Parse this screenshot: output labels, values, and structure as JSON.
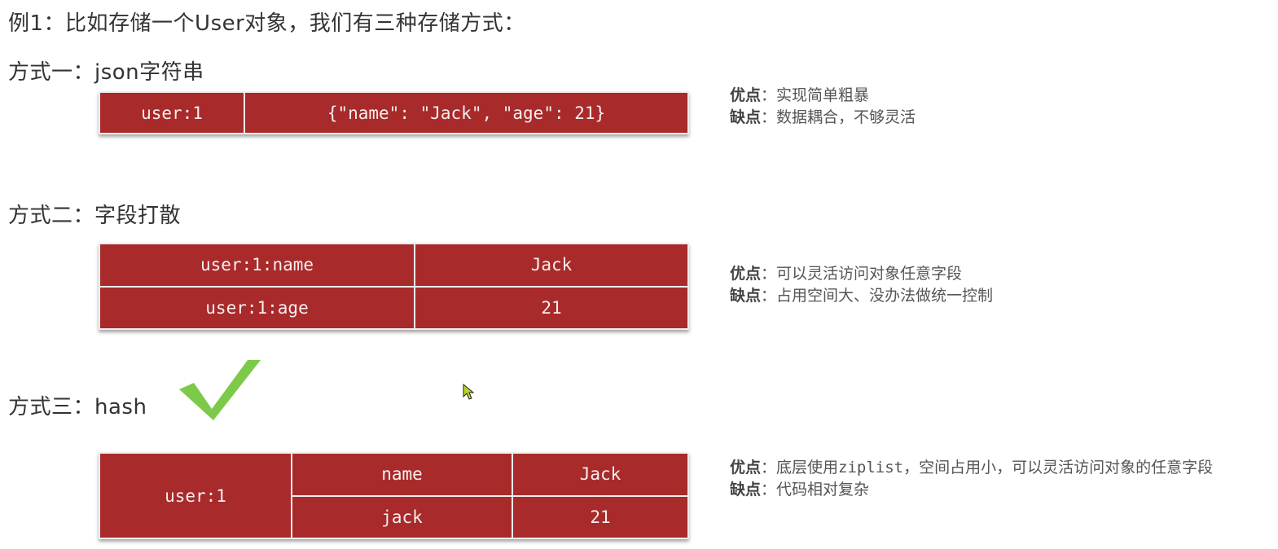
{
  "title": "例1：比如存储一个User对象，我们有三种存储方式：",
  "methods": [
    {
      "heading": "方式一：json字符串",
      "table": {
        "rows": [
          [
            "user:1",
            "{\"name\": \"Jack\", \"age\": 21}"
          ]
        ]
      },
      "pros_label": "优点",
      "pros": "：实现简单粗暴",
      "cons_label": "缺点",
      "cons": "：数据耦合，不够灵活"
    },
    {
      "heading": "方式二：字段打散",
      "table": {
        "rows": [
          [
            "user:1:name",
            "Jack"
          ],
          [
            "user:1:age",
            "21"
          ]
        ]
      },
      "pros_label": "优点",
      "pros": "：可以灵活访问对象任意字段",
      "cons_label": "缺点",
      "cons": "：占用空间大、没办法做统一控制"
    },
    {
      "heading": "方式三：hash",
      "badge_icon": "checkmark-icon",
      "badge_color": "#7dc94a",
      "table": {
        "key": "user:1",
        "fields": [
          [
            "name",
            "Jack"
          ],
          [
            "jack",
            "21"
          ]
        ]
      },
      "pros_label": "优点",
      "pros_prefix": "：底层使用",
      "pros_code": "ziplist",
      "pros_suffix": "，空间占用小，可以灵活访问对象的任意字段",
      "cons_label": "缺点",
      "cons": "：代码相对复杂"
    }
  ],
  "colors": {
    "table_bg": "#a82a2a",
    "table_text": "#f6eeee",
    "check": "#7dc94a",
    "cursor": "#b5d629"
  }
}
